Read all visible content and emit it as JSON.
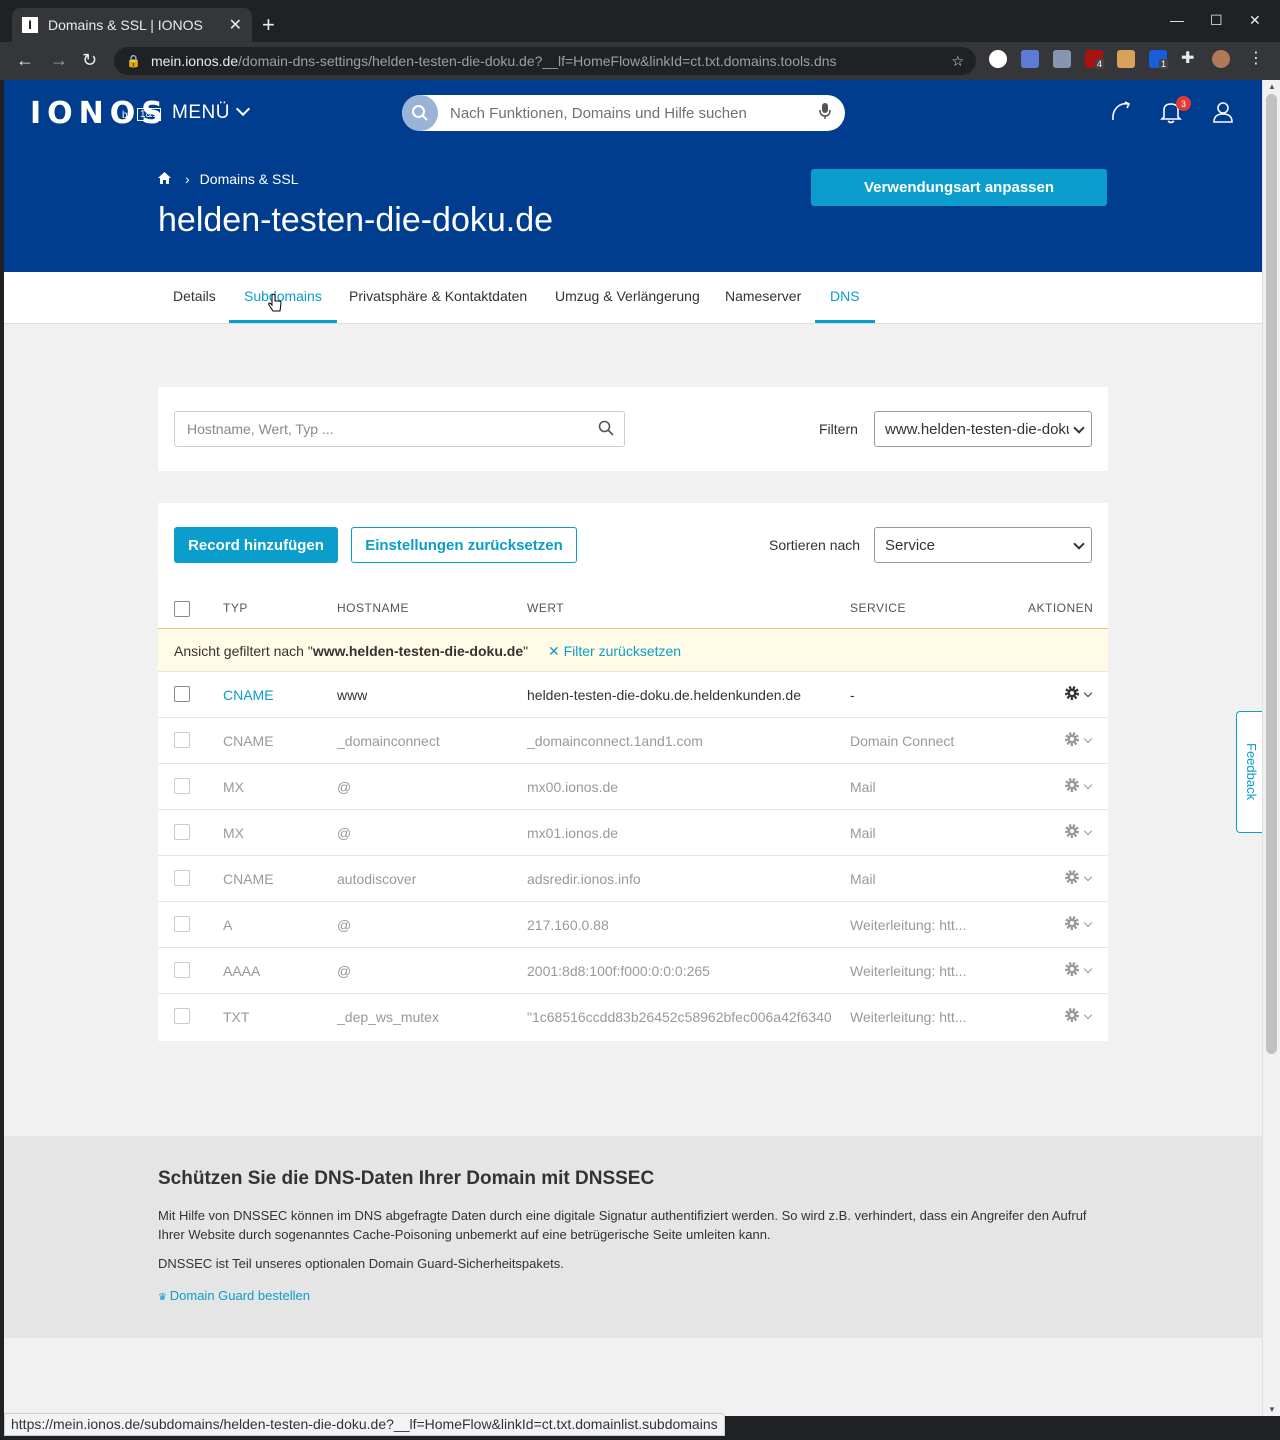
{
  "browser": {
    "tab_title": "Domains & SSL | IONOS",
    "tab_favicon": "I",
    "url_host": "mein.ionos.de",
    "url_path": "/domain-dns-settings/helden-testen-die-doku.de?__lf=HomeFlow&linkId=ct.txt.domains.tools.dns",
    "status_url": "https://mein.ionos.de/subdomains/helden-testen-die-doku.de?__lf=HomeFlow&linkId=ct.txt.domainlist.subdomains",
    "ext_badge_1": "4",
    "ext_badge_2": "1"
  },
  "header": {
    "logo": "IONOS",
    "logo_by": "by",
    "logo_1and1": "1&1",
    "menu_label": "MENÜ",
    "search_placeholder": "Nach Funktionen, Domains und Hilfe suchen",
    "notification_count": "3"
  },
  "hero": {
    "breadcrumb": "Domains & SSL",
    "title": "helden-testen-die-doku.de",
    "cta_label": "Verwendungsart anpassen"
  },
  "tabs": [
    "Details",
    "Subdomains",
    "Privatsphäre & Kontaktdaten",
    "Umzug & Verlängerung",
    "Nameserver",
    "DNS"
  ],
  "filter": {
    "search_placeholder": "Hostname, Wert, Typ ...",
    "label": "Filtern",
    "selected": "www.helden-testen-die-doku.de"
  },
  "records": {
    "add_label": "Record hinzufügen",
    "reset_label": "Einstellungen zurücksetzen",
    "sort_label": "Sortieren nach",
    "sort_selected": "Service",
    "columns": [
      "TYP",
      "HOSTNAME",
      "WERT",
      "SERVICE",
      "AKTIONEN"
    ],
    "filter_notice_prefix": "Ansicht gefiltert nach \"",
    "filter_notice_value": "www.helden-testen-die-doku.de",
    "filter_notice_suffix": "\"",
    "filter_reset": "Filter zurücksetzen",
    "rows": [
      {
        "type": "CNAME",
        "host": "www",
        "value": "helden-testen-die-doku.de.heldenkunden.de",
        "service": "-"
      },
      {
        "type": "CNAME",
        "host": "_domainconnect",
        "value": "_domainconnect.1and1.com",
        "service": "Domain Connect"
      },
      {
        "type": "MX",
        "host": "@",
        "value": "mx00.ionos.de",
        "service": "Mail"
      },
      {
        "type": "MX",
        "host": "@",
        "value": "mx01.ionos.de",
        "service": "Mail"
      },
      {
        "type": "CNAME",
        "host": "autodiscover",
        "value": "adsredir.ionos.info",
        "service": "Mail"
      },
      {
        "type": "A",
        "host": "@",
        "value": "217.160.0.88",
        "service": "Weiterleitung: htt..."
      },
      {
        "type": "AAAA",
        "host": "@",
        "value": "2001:8d8:100f:f000:0:0:0:265",
        "service": "Weiterleitung: htt..."
      },
      {
        "type": "TXT",
        "host": "_dep_ws_mutex",
        "value": "\"1c68516ccdd83b26452c58962bfec006a42f6340...",
        "service": "Weiterleitung: htt..."
      }
    ]
  },
  "feedback_label": "Feedback",
  "dnssec": {
    "title": "Schützen Sie die DNS-Daten Ihrer Domain mit DNSSEC",
    "text1": "Mit Hilfe von DNSSEC können im DNS abgefragte Daten durch eine digitale Signatur authentifiziert werden. So wird z.B. verhindert, dass ein Angreifer den Aufruf Ihrer Website durch sogenanntes Cache-Poisoning unbemerkt auf eine betrügerische Seite umleiten kann.",
    "text2": "DNSSEC ist Teil unseres optionalen Domain Guard-Sicherheitspakets.",
    "link": "Domain Guard bestellen"
  },
  "colors": {
    "brand_blue": "#003d8f",
    "accent": "#0b9dcc"
  }
}
